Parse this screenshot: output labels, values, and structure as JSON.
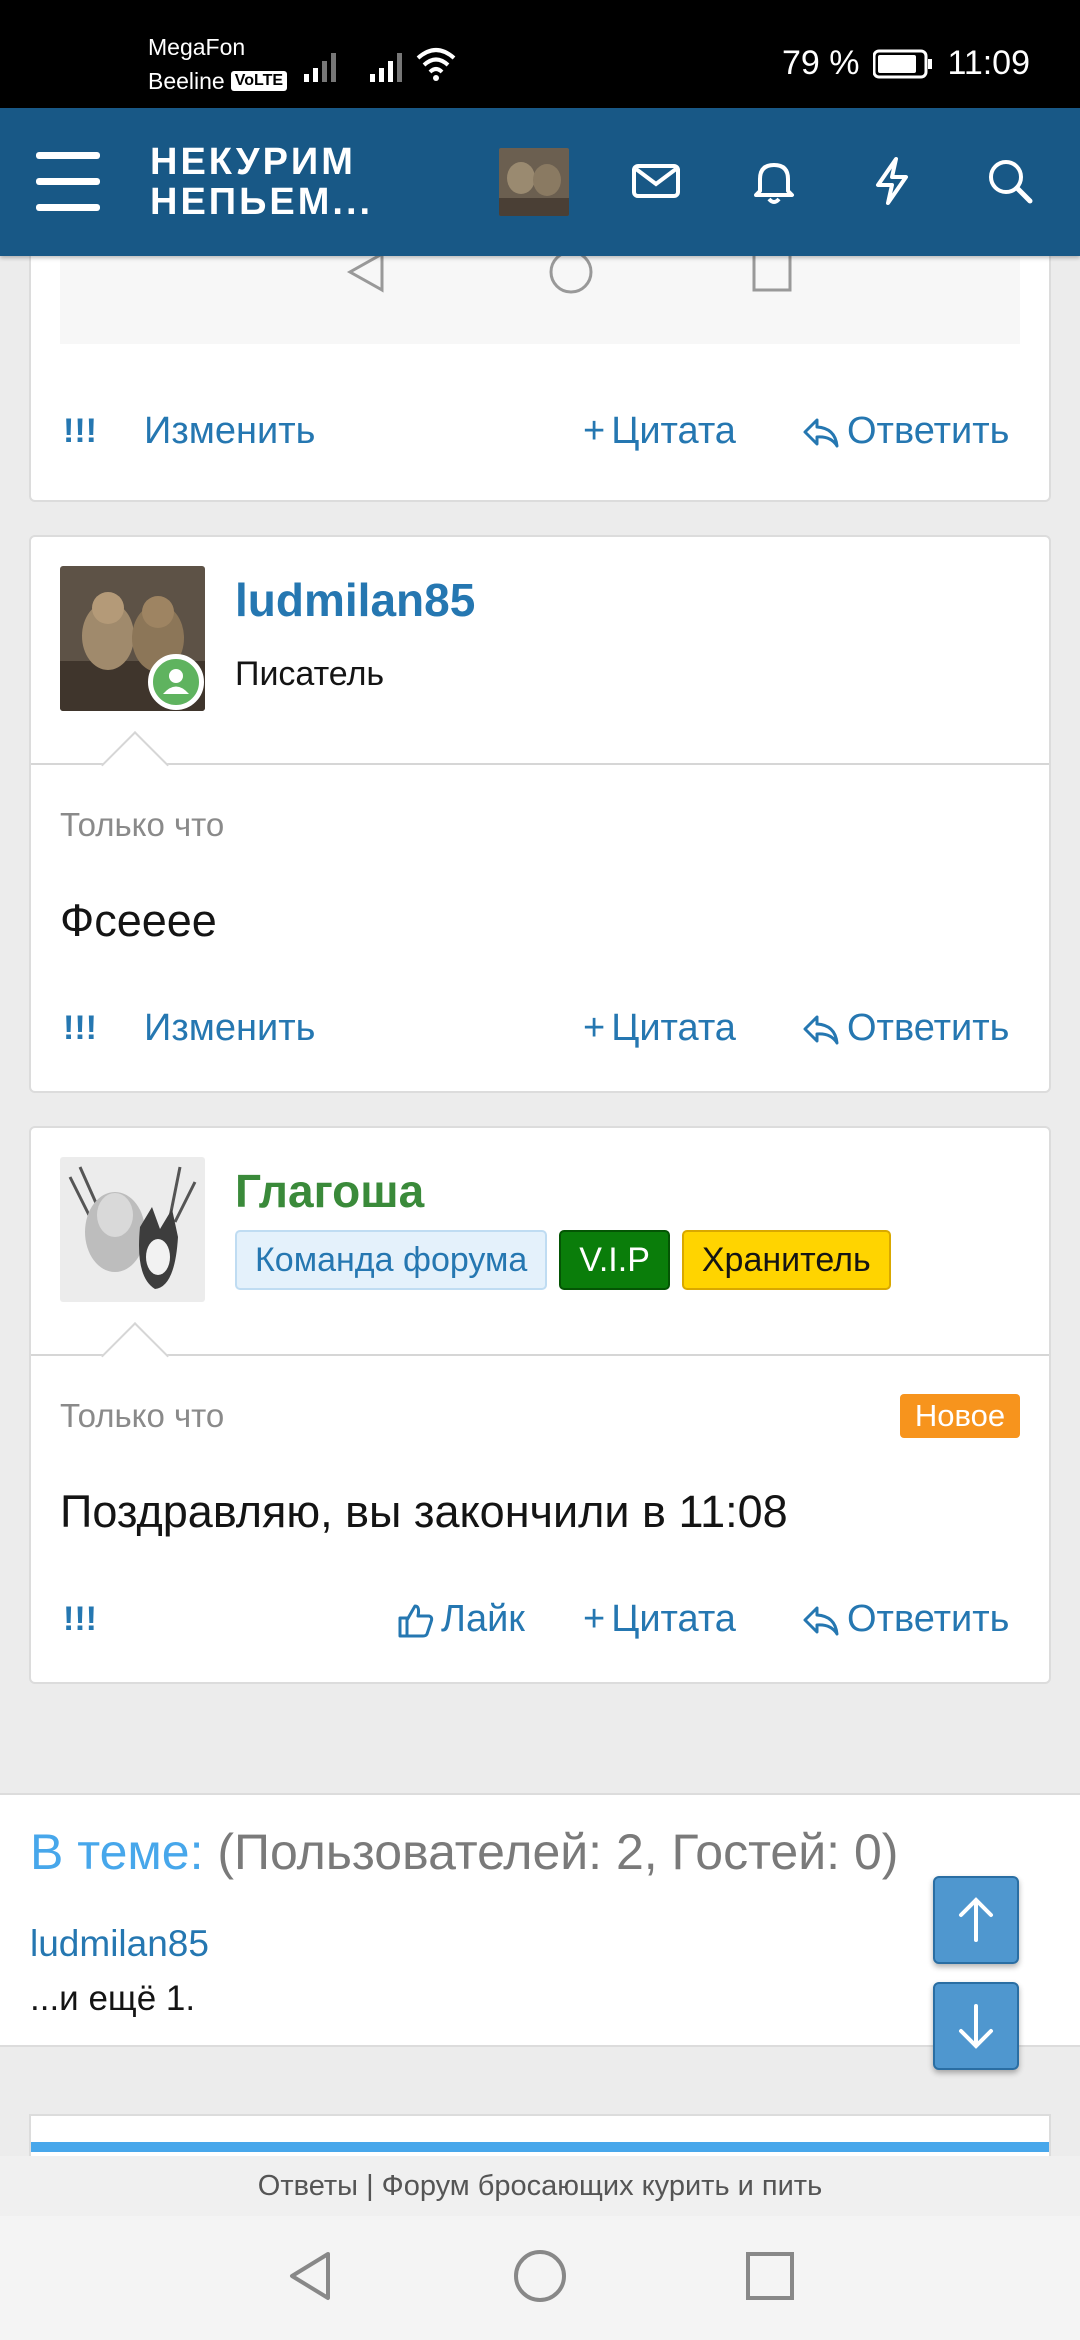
{
  "status_bar": {
    "carrier1": "MegaFon",
    "carrier2": "Beeline",
    "volte": "VoLTE",
    "battery": "79 %",
    "time": "11:09"
  },
  "header": {
    "logo_line1": "НЕКУРИМ",
    "logo_line2": "НЕПЬЕМ..."
  },
  "actions": {
    "report": "!!!",
    "edit": "Изменить",
    "quote": "Цитата",
    "reply": "Ответить",
    "like": "Лайк"
  },
  "posts": [
    {
      "author": "ludmilan85",
      "user_title": "Писатель",
      "time": "Только что",
      "message": "Фсееее"
    },
    {
      "author": "Глагоша",
      "roles": [
        "Команда форума",
        "V.I.P",
        "Хранитель"
      ],
      "time": "Только что",
      "badge": "Новое",
      "message": "Поздравляю, вы закончили в 11:08"
    }
  ],
  "online": {
    "label": "В теме:",
    "counts": "(Пользователей: 2, Гостей: 0)",
    "user": "ludmilan85",
    "more": "...и ещё 1."
  },
  "page_label": "Ответы | Форум бросающих курить и пить",
  "colors": {
    "header_bg": "#185886",
    "link": "#2577b1",
    "new_badge": "#f7941d",
    "vip": "#0a7d0a",
    "keeper": "#ffd400",
    "author2": "#3a8a3a"
  }
}
